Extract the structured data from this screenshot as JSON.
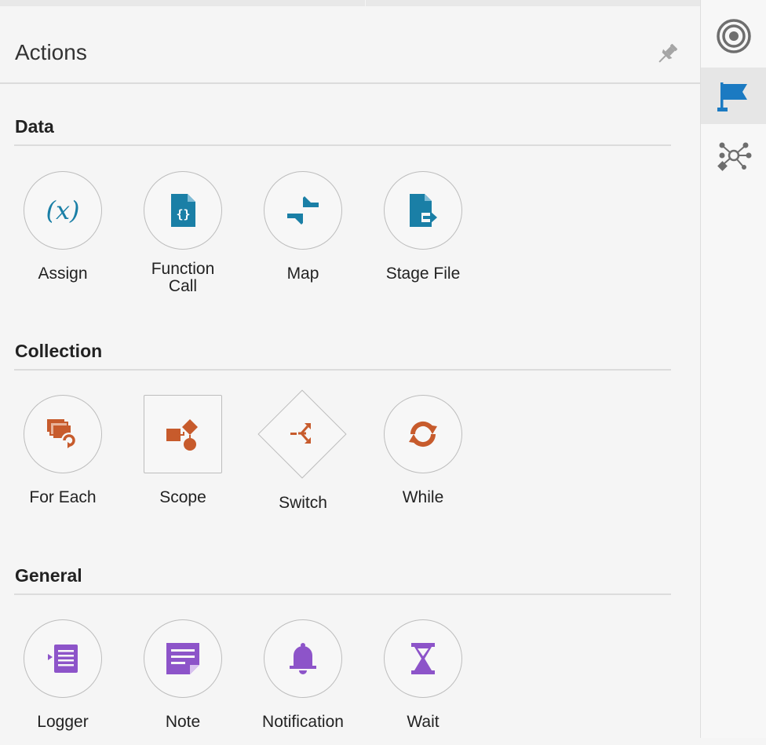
{
  "panel": {
    "title": "Actions"
  },
  "sections": [
    {
      "title": "Data",
      "items": [
        {
          "label": "Assign",
          "icon": "assign-icon"
        },
        {
          "label": "Function\nCall",
          "icon": "function-call-icon"
        },
        {
          "label": "Map",
          "icon": "map-icon"
        },
        {
          "label": "Stage File",
          "icon": "stage-file-icon"
        }
      ]
    },
    {
      "title": "Collection",
      "items": [
        {
          "label": "For Each",
          "icon": "for-each-icon"
        },
        {
          "label": "Scope",
          "icon": "scope-icon"
        },
        {
          "label": "Switch",
          "icon": "switch-icon"
        },
        {
          "label": "While",
          "icon": "while-icon"
        }
      ]
    },
    {
      "title": "General",
      "items": [
        {
          "label": "Logger",
          "icon": "logger-icon"
        },
        {
          "label": "Note",
          "icon": "note-icon"
        },
        {
          "label": "Notification",
          "icon": "notification-icon"
        },
        {
          "label": "Wait",
          "icon": "wait-icon"
        }
      ]
    }
  ],
  "sidebar": {
    "buttons": [
      {
        "icon": "target-icon",
        "active": false
      },
      {
        "icon": "flag-icon",
        "active": true
      },
      {
        "icon": "network-icon",
        "active": false
      }
    ]
  },
  "colors": {
    "data": "#1a7fa6",
    "collection": "#c75b2c",
    "general": "#8d54c9",
    "sidebar_active": "#1b7ac2"
  }
}
